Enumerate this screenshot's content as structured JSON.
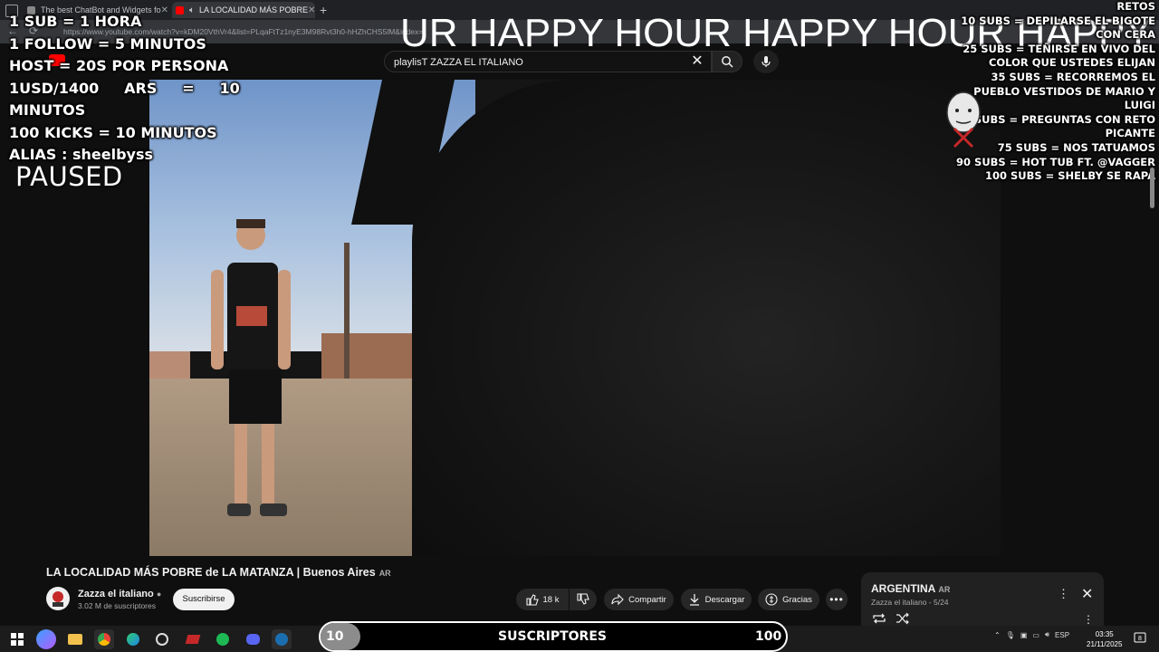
{
  "browser": {
    "tabs": [
      {
        "label": "The best ChatBot and Widgets fo"
      },
      {
        "label": "LA LOCALIDAD MÁS POBRE"
      }
    ],
    "url": "https://www.youtube.com/watch?v=kDM20VthVr4&list=PLqaFtTz1nyE3M98Rvt3h0-hHZhCHS5lM&index="
  },
  "youtube": {
    "search_value": "playlisT ZAZZA EL ITALIANO",
    "video_title": "LA LOCALIDAD MÁS POBRE de LA MATANZA | Buenos Aires",
    "video_title_badge": "AR",
    "channel_name": "Zazza el italiano",
    "channel_subs": "3.02 M de suscriptores",
    "subscribe_label": "Suscribirse",
    "like_count": "18 k",
    "share_label": "Compartir",
    "download_label": "Descargar",
    "thanks_label": "Gracias",
    "playlist": {
      "title": "ARGENTINA",
      "badge": "AR",
      "meta": "Zazza el italiano - 5/24"
    }
  },
  "overlay": {
    "left_lines": [
      "1 SUB = 1 HORA",
      "1 FOLLOW  = 5 MINUTOS",
      "HOST = 20S POR PERSONA",
      "1USD/1400     ARS     =     10",
      "MINUTOS",
      "100 KICKS = 10 MINUTOS",
      "ALIAS : sheelbyss"
    ],
    "paused": "PAUSED",
    "marquee": "UR HAPPY HOUR HAPPY HOUR HAPPY HO",
    "retos_lines": [
      "RETOS",
      "10 SUBS = DEPILARSE EL BIGOTE",
      "CON CERA",
      "25 SUBS = TEÑIRSE EN VIVO DEL",
      "COLOR QUE USTEDES ELIJAN",
      "35 SUBS = RECORREMOS EL",
      "PUEBLO VESTIDOS DE MARIO Y",
      "LUIGI",
      "50 SUBS = PREGUNTAS CON RETO",
      "PICANTE",
      "75 SUBS = NOS TATUAMOS",
      "90 SUBS  = HOT TUB FT. @VAGGER",
      "100 SUBS = SHELBY SE RAPA"
    ],
    "sub_goal": {
      "current": "10",
      "label": "SUSCRIPTORES",
      "goal": "100",
      "progress_fraction": 0.1
    }
  },
  "taskbar": {
    "language": "ESP",
    "time": "03:35",
    "date": "21/11/2025",
    "notifications": "8"
  },
  "colors": {
    "yt_bg": "#0f0f0f",
    "pill_bg": "#272727",
    "subscribe_bg": "#f1f1f1",
    "taskbar_bg": "#1c1c1c"
  }
}
